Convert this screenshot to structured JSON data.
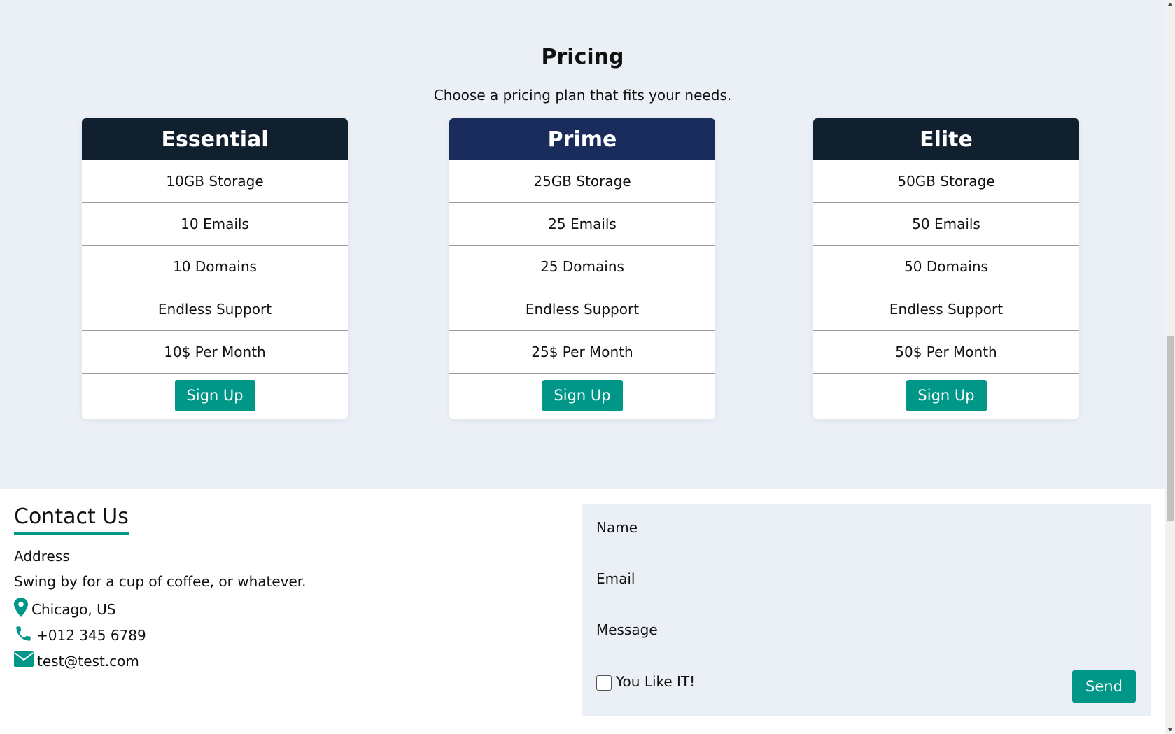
{
  "pricing": {
    "title": "Pricing",
    "subtitle": "Choose a pricing plan that fits your needs.",
    "plans": [
      {
        "name": "Essential",
        "header_color": "#11202f",
        "features": [
          "10GB Storage",
          "10 Emails",
          "10 Domains",
          "Endless Support",
          "10$ Per Month"
        ],
        "button_label": "Sign Up"
      },
      {
        "name": "Prime",
        "header_color": "#1a2c5c",
        "features": [
          "25GB Storage",
          "25 Emails",
          "25 Domains",
          "Endless Support",
          "25$ Per Month"
        ],
        "button_label": "Sign Up"
      },
      {
        "name": "Elite",
        "header_color": "#11202f",
        "features": [
          "50GB Storage",
          "50 Emails",
          "50 Domains",
          "Endless Support",
          "50$ Per Month"
        ],
        "button_label": "Sign Up"
      }
    ]
  },
  "contact": {
    "title": "Contact Us",
    "address_label": "Address",
    "tagline": "Swing by for a cup of coffee, or whatever.",
    "location": "Chicago, US",
    "phone": "+012 345 6789",
    "email": "test@test.com",
    "icons": [
      "map-pin-icon",
      "phone-icon",
      "envelope-icon"
    ]
  },
  "form": {
    "name_label": "Name",
    "email_label": "Email",
    "message_label": "Message",
    "checkbox_label": "You Like IT!",
    "checkbox_checked": false,
    "send_label": "Send"
  },
  "colors": {
    "accent": "#009688",
    "section_bg": "#ebf0f6",
    "dark_header": "#11202f",
    "prime_header": "#1a2c5c"
  }
}
